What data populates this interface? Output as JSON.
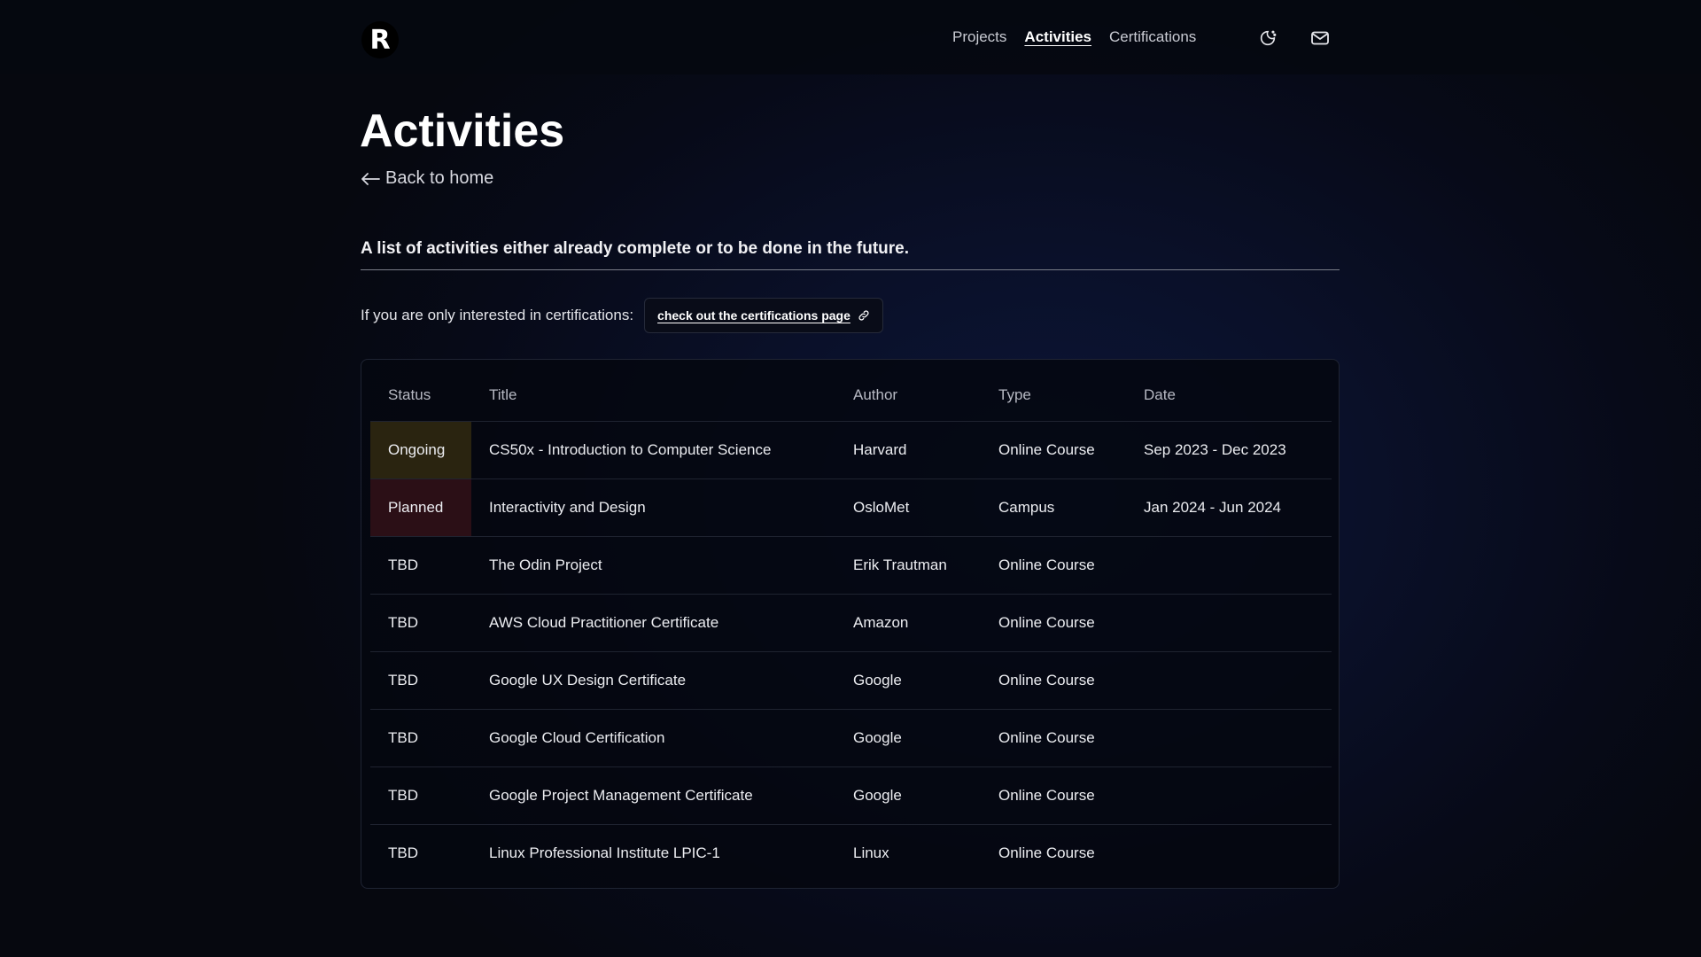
{
  "header": {
    "logo_text": "R",
    "nav": [
      {
        "label": "Projects",
        "active": false
      },
      {
        "label": "Activities",
        "active": true
      },
      {
        "label": "Certifications",
        "active": false
      }
    ],
    "icons": [
      "theme-toggle-icon",
      "mail-icon"
    ]
  },
  "main": {
    "title": "Activities",
    "back_label": "Back to home",
    "subtitle": "A list of activities either already complete or to be done in the future.",
    "cert_prompt": "If you are only interested in certifications:",
    "cert_link": "check out the certifications page"
  },
  "table": {
    "columns": [
      "Status",
      "Title",
      "Author",
      "Type",
      "Date"
    ],
    "rows": [
      {
        "status": "Ongoing",
        "title": "CS50x - Introduction to Computer Science",
        "author": "Harvard",
        "type": "Online Course",
        "date": "Sep 2023 - Dec 2023"
      },
      {
        "status": "Planned",
        "title": "Interactivity and Design",
        "author": "OsloMet",
        "type": "Campus",
        "date": "Jan 2024 - Jun 2024"
      },
      {
        "status": "TBD",
        "title": "The Odin Project",
        "author": "Erik Trautman",
        "type": "Online Course",
        "date": ""
      },
      {
        "status": "TBD",
        "title": "AWS Cloud Practitioner Certificate",
        "author": "Amazon",
        "type": "Online Course",
        "date": ""
      },
      {
        "status": "TBD",
        "title": "Google UX Design Certificate",
        "author": "Google",
        "type": "Online Course",
        "date": ""
      },
      {
        "status": "TBD",
        "title": "Google Cloud Certification",
        "author": "Google",
        "type": "Online Course",
        "date": ""
      },
      {
        "status": "TBD",
        "title": "Google Project Management Certificate",
        "author": "Google",
        "type": "Online Course",
        "date": ""
      },
      {
        "status": "TBD",
        "title": "Linux Professional Institute LPIC-1",
        "author": "Linux",
        "type": "Online Course",
        "date": ""
      }
    ]
  },
  "colors": {
    "ongoing_bg": "#2a2410",
    "planned_bg": "#2b0f16",
    "page_bg": "#070a18"
  }
}
